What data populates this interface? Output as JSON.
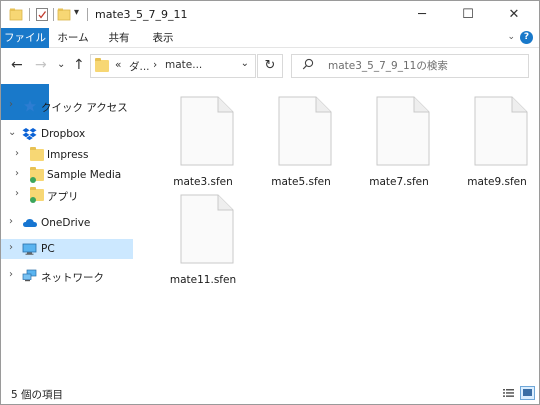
{
  "window": {
    "title": "mate3_5_7_9_11",
    "controls": {
      "minimize": "─",
      "maximize": "☐",
      "close": "✕"
    }
  },
  "quick_access_toolbar": {
    "dropdown": "▾",
    "icons": [
      "folder-icon",
      "properties-icon",
      "new-folder-icon"
    ]
  },
  "ribbon": {
    "tabs": [
      {
        "label": "ファイル",
        "active": true
      },
      {
        "label": "ホーム"
      },
      {
        "label": "共有"
      },
      {
        "label": "表示"
      }
    ],
    "expand": "⌄",
    "help": "?"
  },
  "navigation": {
    "back": "←",
    "forward": "→",
    "recent": "⌄",
    "up": "↑",
    "breadcrumb": {
      "overflow": "«",
      "segments": [
        "ダ...",
        "mate..."
      ],
      "separator": "›",
      "dropdown": "⌄"
    },
    "refresh": "↻",
    "search": {
      "placeholder": "mate3_5_7_9_11の検索",
      "icon": "⌕"
    }
  },
  "sidebar": {
    "items": [
      {
        "label": "クイック アクセス",
        "icon": "star-icon",
        "chevron": "›",
        "expanded": false
      },
      {
        "label": "Dropbox",
        "icon": "dropbox-icon",
        "chevron": "⌄",
        "expanded": true
      },
      {
        "label": "Impress",
        "icon": "folder-icon",
        "chevron": "›"
      },
      {
        "label": "Sample Media",
        "icon": "folder-icon",
        "chevron": "›"
      },
      {
        "label": "アプリ",
        "icon": "folder-icon",
        "chevron": "›"
      },
      {
        "label": "OneDrive",
        "icon": "cloud-icon",
        "chevron": "›"
      },
      {
        "label": "PC",
        "icon": "computer-icon",
        "chevron": "›",
        "selected": true
      },
      {
        "label": "ネットワーク",
        "icon": "network-icon",
        "chevron": "›"
      }
    ]
  },
  "files": [
    {
      "name": "mate3.sfen"
    },
    {
      "name": "mate5.sfen"
    },
    {
      "name": "mate7.sfen"
    },
    {
      "name": "mate9.sfen"
    },
    {
      "name": "mate11.sfen"
    }
  ],
  "status": {
    "item_count": "5 個の項目"
  },
  "colors": {
    "accent": "#1979ca",
    "selection": "#cce8ff",
    "folder": "#f7d774"
  }
}
